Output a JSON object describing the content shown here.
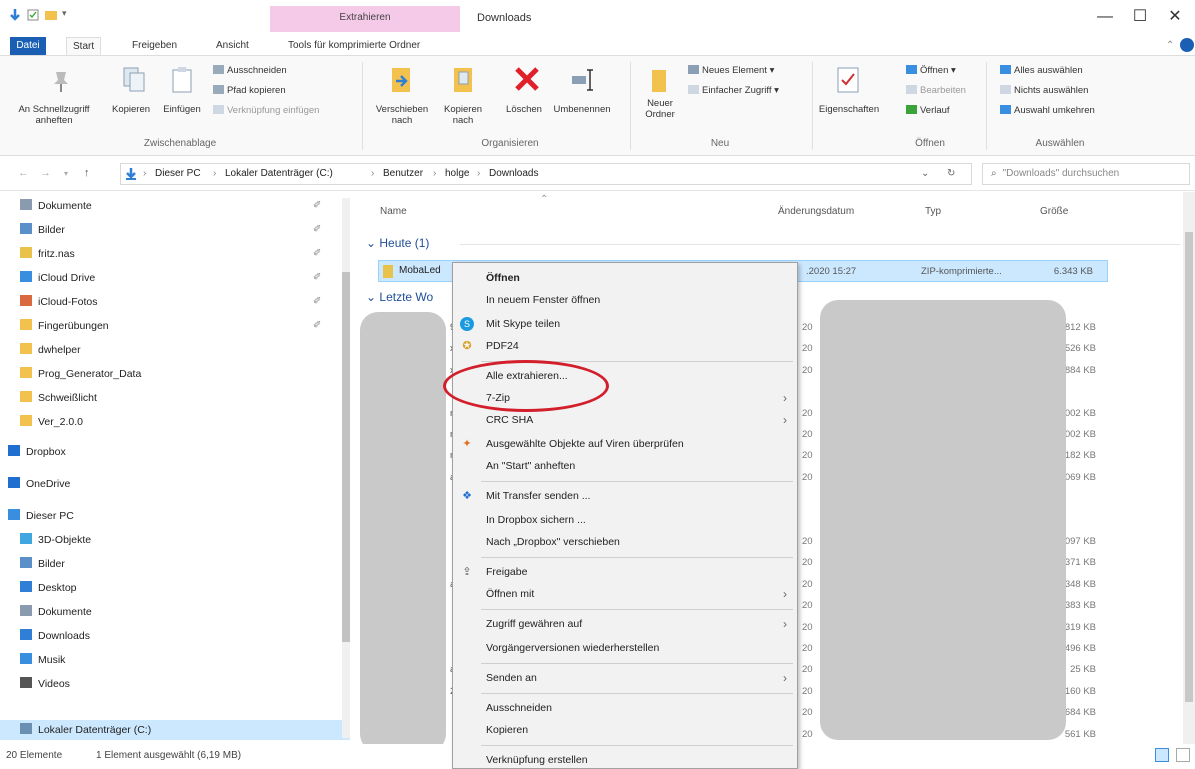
{
  "titlebar": {
    "context_tab": "Extrahieren",
    "title": "Downloads",
    "minimize": "—",
    "maximize": "☐",
    "close": "✕"
  },
  "tabs": {
    "file": "Datei",
    "start": "Start",
    "share": "Freigeben",
    "view": "Ansicht",
    "compressed_tools": "Tools für komprimierte Ordner"
  },
  "ribbon": {
    "clipboard": {
      "pin": "An Schnellzugriff anheften",
      "copy": "Kopieren",
      "paste": "Einfügen",
      "cut": "Ausschneiden",
      "copy_path": "Pfad kopieren",
      "paste_shortcut": "Verknüpfung einfügen",
      "label": "Zwischenablage"
    },
    "organize": {
      "move": "Verschieben nach",
      "copy_to": "Kopieren nach",
      "delete": "Löschen",
      "rename": "Umbenennen",
      "label": "Organisieren"
    },
    "new": {
      "new_folder": "Neuer Ordner",
      "new_item": "Neues Element",
      "easy_access": "Einfacher Zugriff",
      "label": "Neu"
    },
    "open": {
      "properties": "Eigenschaften",
      "open": "Öffnen",
      "edit": "Bearbeiten",
      "history": "Verlauf",
      "label": "Öffnen"
    },
    "select": {
      "select_all": "Alles auswählen",
      "select_none": "Nichts auswählen",
      "invert": "Auswahl umkehren",
      "label": "Auswählen"
    }
  },
  "address": {
    "crumbs": [
      "Dieser PC",
      "Lokaler Datenträger (C:)",
      "Benutzer",
      "holge",
      "Downloads"
    ],
    "search_placeholder": "\"Downloads\" durchsuchen"
  },
  "sidebar": {
    "items": [
      {
        "label": "Dokumente",
        "color": "#8a9bb0",
        "pinned": true
      },
      {
        "label": "Bilder",
        "color": "#5a8fc7",
        "pinned": true
      },
      {
        "label": "fritz.nas",
        "color": "#e8c24a",
        "pinned": true
      },
      {
        "label": "iCloud Drive",
        "color": "#3a8ee0",
        "pinned": true
      },
      {
        "label": "iCloud-Fotos",
        "color": "#d96a3f",
        "pinned": true
      },
      {
        "label": "Fingerübungen",
        "color": "#f2c14e",
        "pinned": true
      },
      {
        "label": "dwhelper",
        "color": "#f2c14e",
        "pinned": false
      },
      {
        "label": "Prog_Generator_Data",
        "color": "#f2c14e",
        "pinned": false
      },
      {
        "label": "Schweißlicht",
        "color": "#f2c14e",
        "pinned": false
      },
      {
        "label": "Ver_2.0.0",
        "color": "#f2c14e",
        "pinned": false
      },
      {
        "label": "Dropbox",
        "color": "#1f6fd1",
        "pinned": false
      },
      {
        "label": "OneDrive",
        "color": "#1f6fd1",
        "pinned": false
      },
      {
        "label": "Dieser PC",
        "color": "#3a8ee0",
        "pinned": false
      },
      {
        "label": "3D-Objekte",
        "color": "#3fa6e0",
        "pinned": false
      },
      {
        "label": "Bilder",
        "color": "#5a8fc7",
        "pinned": false
      },
      {
        "label": "Desktop",
        "color": "#2f7fd6",
        "pinned": false
      },
      {
        "label": "Dokumente",
        "color": "#8a9bb0",
        "pinned": false
      },
      {
        "label": "Downloads",
        "color": "#2f7fd6",
        "pinned": false
      },
      {
        "label": "Musik",
        "color": "#3a8ee0",
        "pinned": false
      },
      {
        "label": "Videos",
        "color": "#555",
        "pinned": false
      },
      {
        "label": "Lokaler Datenträger (C:)",
        "color": "#6b8fb0",
        "pinned": false
      }
    ]
  },
  "content": {
    "columns": {
      "name": "Name",
      "date": "Änderungsdatum",
      "type": "Typ",
      "size": "Größe"
    },
    "group_today": "Heute (1)",
    "group_last_week": "Letzte Wo",
    "selected_file": {
      "name": "MobaLed",
      "date": ".2020 15:27",
      "type": "ZIP-komprimierte...",
      "size": "6.343 KB"
    },
    "rows": [
      {
        "stub": "95",
        "date": "20",
        "size": "2.812 KB"
      },
      {
        "stub": "x",
        "date": "20",
        "size": "1.526 KB"
      },
      {
        "stub": "x",
        "date": "20",
        "size": "3.884 KB"
      },
      {
        "stub": "",
        "date": "",
        "size": ""
      },
      {
        "stub": "n",
        "date": "20",
        "size": "1.002 KB"
      },
      {
        "stub": "n",
        "date": "20",
        "size": "1.002 KB"
      },
      {
        "stub": "n",
        "date": "20",
        "size": "182 KB"
      },
      {
        "stub": "a",
        "date": "20",
        "size": "1.069 KB"
      },
      {
        "stub": "",
        "date": "",
        "size": ""
      },
      {
        "stub": "",
        "date": "",
        "size": ""
      },
      {
        "stub": "",
        "date": "20",
        "size": "3.097 KB"
      },
      {
        "stub": "",
        "date": "20",
        "size": "371 KB"
      },
      {
        "stub": "a",
        "date": "20",
        "size": "348 KB"
      },
      {
        "stub": "",
        "date": "20",
        "size": "383 KB"
      },
      {
        "stub": "",
        "date": "20",
        "size": "319 KB"
      },
      {
        "stub": "",
        "date": "20",
        "size": "9.496 KB"
      },
      {
        "stub": "a",
        "date": "20",
        "size": "25 KB"
      },
      {
        "stub": "2",
        "date": "20",
        "size": "160 KB"
      },
      {
        "stub": "",
        "date": "20",
        "size": "684 KB"
      },
      {
        "stub": "",
        "date": "20",
        "size": "561 KB"
      }
    ]
  },
  "status": {
    "count": "20 Elemente",
    "selection": "1 Element ausgewählt (6,19 MB)"
  },
  "context_menu": {
    "open": "Öffnen",
    "open_new_window": "In neuem Fenster öffnen",
    "skype": "Mit Skype teilen",
    "pdf24": "PDF24",
    "extract_all": "Alle extrahieren...",
    "seven_zip": "7-Zip",
    "crc_sha": "CRC SHA",
    "virus_scan": "Ausgewählte Objekte auf Viren überprüfen",
    "pin_start": "An \"Start\" anheften",
    "transfer": "Mit Transfer senden ...",
    "dropbox_save": "In Dropbox sichern ...",
    "dropbox_move": "Nach „Dropbox\" verschieben",
    "share": "Freigabe",
    "open_with": "Öffnen mit",
    "grant_access": "Zugriff gewähren auf",
    "restore_versions": "Vorgängerversionen wiederherstellen",
    "send_to": "Senden an",
    "cut": "Ausschneiden",
    "copy": "Kopieren",
    "create_shortcut": "Verknüpfung erstellen"
  },
  "colors": {
    "accent": "#1a5fb4",
    "selection": "#cce8ff",
    "context_tab": "#f5c9e8",
    "highlight_ellipse": "#d21f2b"
  }
}
